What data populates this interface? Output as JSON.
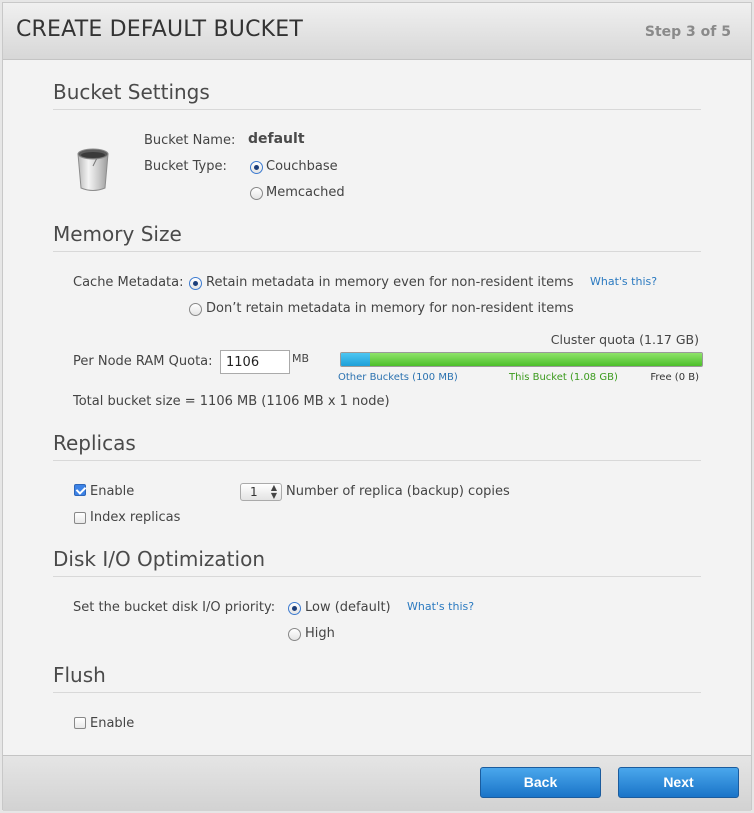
{
  "header": {
    "title": "CREATE DEFAULT BUCKET",
    "step": "Step 3 of 5"
  },
  "bucket_settings": {
    "title": "Bucket Settings",
    "name_label": "Bucket Name:",
    "name_value": "default",
    "type_label": "Bucket Type:",
    "types": [
      {
        "label": "Couchbase",
        "checked": true
      },
      {
        "label": "Memcached",
        "checked": false
      }
    ],
    "icon": "bucket-icon"
  },
  "memory": {
    "title": "Memory Size",
    "cache_label": "Cache Metadata:",
    "cache_options": [
      {
        "label": "Retain metadata in memory even for non-resident items",
        "checked": true
      },
      {
        "label": "Don’t retain metadata in memory for non-resident items",
        "checked": false
      }
    ],
    "whats_this": "What's this?",
    "cluster_quota": "Cluster quota (1.17 GB)",
    "ram_label": "Per Node RAM Quota:",
    "ram_value": "1106",
    "ram_unit": "MB",
    "bar": {
      "other_fraction": 0.08,
      "this_fraction": 0.92,
      "other_label": "Other Buckets (100 MB)",
      "this_label": "This Bucket (1.08 GB)",
      "free_label": "Free (0 B)",
      "colors": {
        "other": "#1ea0d8",
        "this": "#4cbf2a"
      }
    },
    "total": "Total bucket size = 1106 MB (1106 MB x 1 node)"
  },
  "replicas": {
    "title": "Replicas",
    "enable_label": "Enable",
    "enable_checked": true,
    "count_value": "1",
    "count_label": "Number of replica (backup) copies",
    "index_label": "Index replicas",
    "index_checked": false
  },
  "disk": {
    "title": "Disk I/O Optimization",
    "priority_label": "Set the bucket disk I/O priority:",
    "options": [
      {
        "label": "Low (default)",
        "checked": true
      },
      {
        "label": "High",
        "checked": false
      }
    ],
    "whats_this": "What's this?"
  },
  "flush": {
    "title": "Flush",
    "enable_label": "Enable",
    "enable_checked": false
  },
  "footer": {
    "back_label": "Back",
    "next_label": "Next"
  },
  "accent_color": "#1a74c8"
}
